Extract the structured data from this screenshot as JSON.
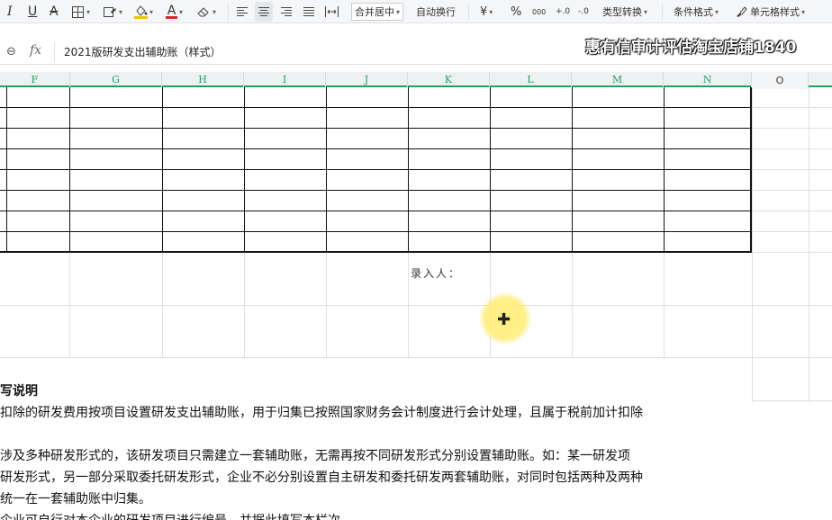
{
  "toolbar": {
    "italic": "I",
    "underline": "U",
    "strike": "A",
    "font_color": "A",
    "merge_label": "合并居中",
    "wrap_label": "自动换行",
    "currency_symbol": "¥",
    "percent_symbol": "%",
    "thousands_symbol": "000",
    "inc_decimal": "+.0",
    "dec_decimal": "-.0",
    "type_convert_label": "类型转换",
    "cond_format_label": "条件格式",
    "cell_style_label": "单元格样式",
    "accent_color": "#20a162",
    "font_color_swatch": "#d9262a",
    "fill_color_swatch": "#f2c200"
  },
  "formula_bar": {
    "fx": "fx",
    "value": "2021版研发支出辅助账（样式）"
  },
  "watermark": "惠有信审计评估淘宝店铺1840",
  "columns": [
    "F",
    "G",
    "H",
    "I",
    "J",
    "K",
    "L",
    "M",
    "N",
    "O"
  ],
  "sheet": {
    "recorder_label": "录入人：",
    "notes_title": "写说明",
    "notes_lines": [
      "扣除的研发费用按项目设置研发支出辅助账，用于归集已按照国家财务会计制度进行会计处理，且属于税前加计扣除",
      "",
      "涉及多种研发形式的，该研发项目只需建立一套辅助账，无需再按不同研发形式分别设置辅助账。如：某一研发项",
      "研发形式，另一部分采取委托研发形式，企业不必分别设置自主研发和委托研发两套辅助账，对同时包括两种及两种",
      "统一在一套辅助账中归集。",
      "企业可自行对本企业的研发项目进行编号，并据此填写本栏次。"
    ]
  }
}
